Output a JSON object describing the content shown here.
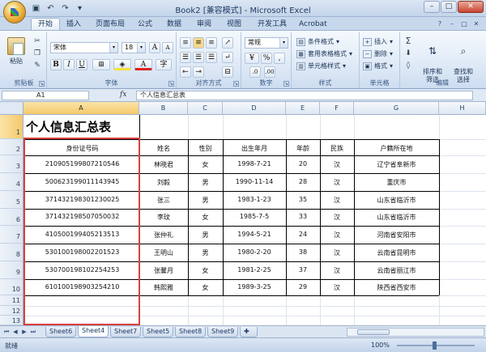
{
  "window": {
    "title": "Book2  [兼容模式] - Microsoft Excel"
  },
  "tabs": [
    "开始",
    "插入",
    "页面布局",
    "公式",
    "数据",
    "审阅",
    "视图",
    "开发工具",
    "Acrobat"
  ],
  "ribbon": {
    "clipboard": {
      "paste_label": "粘贴",
      "group_label": "剪贴板"
    },
    "font": {
      "font_name": "宋体",
      "font_size": "18",
      "group_label": "字体",
      "bold": "B",
      "italic": "I",
      "underline": "U"
    },
    "alignment": {
      "group_label": "对齐方式"
    },
    "number": {
      "format": "常规",
      "percent": "%",
      "comma": ",",
      "group_label": "数字"
    },
    "styles": {
      "conditional": "条件格式",
      "table_format": "套用表格格式",
      "cell_style": "单元格样式",
      "group_label": "样式"
    },
    "cells": {
      "insert": "插入",
      "delete": "删除",
      "format": "格式",
      "group_label": "单元格"
    },
    "editing": {
      "sort": "排序和\n筛选",
      "find": "查找和\n选择",
      "group_label": "编辑"
    }
  },
  "formula_bar": {
    "name_box": "A1",
    "fx": "fx",
    "value": "个人信息汇总表"
  },
  "columns": [
    "A",
    "B",
    "C",
    "D",
    "E",
    "F",
    "G",
    "H"
  ],
  "rows": [
    "1",
    "2",
    "3",
    "4",
    "5",
    "6",
    "7",
    "8",
    "9",
    "10",
    "11",
    "12",
    "13"
  ],
  "sheet": {
    "title": "个人信息汇总表",
    "headers": [
      "身份证号码",
      "姓名",
      "性别",
      "出生年月",
      "年龄",
      "民族",
      "户籍所在地"
    ],
    "records": [
      [
        "210905199807210546",
        "林晓君",
        "女",
        "1998-7-21",
        "20",
        "汉",
        "辽宁省阜新市"
      ],
      [
        "500623199011143945",
        "刘毅",
        "男",
        "1990-11-14",
        "28",
        "汉",
        "重庆市"
      ],
      [
        "371432198301230025",
        "张三",
        "男",
        "1983-1-23",
        "35",
        "汉",
        "山东省临沂市"
      ],
      [
        "371432198507050032",
        "李玟",
        "女",
        "1985-7-5",
        "33",
        "汉",
        "山东省临沂市"
      ],
      [
        "410500199405213513",
        "张仲礼",
        "男",
        "1994-5-21",
        "24",
        "汉",
        "河南省安阳市"
      ],
      [
        "530100198002201523",
        "王明山",
        "男",
        "1980-2-20",
        "38",
        "汉",
        "云南省昆明市"
      ],
      [
        "530700198102254253",
        "张馨月",
        "女",
        "1981-2-25",
        "37",
        "汉",
        "云南省丽江市"
      ],
      [
        "610100198903254210",
        "韩熙雅",
        "女",
        "1989-3-25",
        "29",
        "汉",
        "陕西省西安市"
      ]
    ]
  },
  "sheet_tabs": [
    "Sheet6",
    "Sheet4",
    "Sheet7",
    "Sheet5",
    "Sheet8",
    "Sheet9"
  ],
  "active_sheet": "Sheet4",
  "status": {
    "ready": "就绪",
    "zoom": "100%"
  }
}
